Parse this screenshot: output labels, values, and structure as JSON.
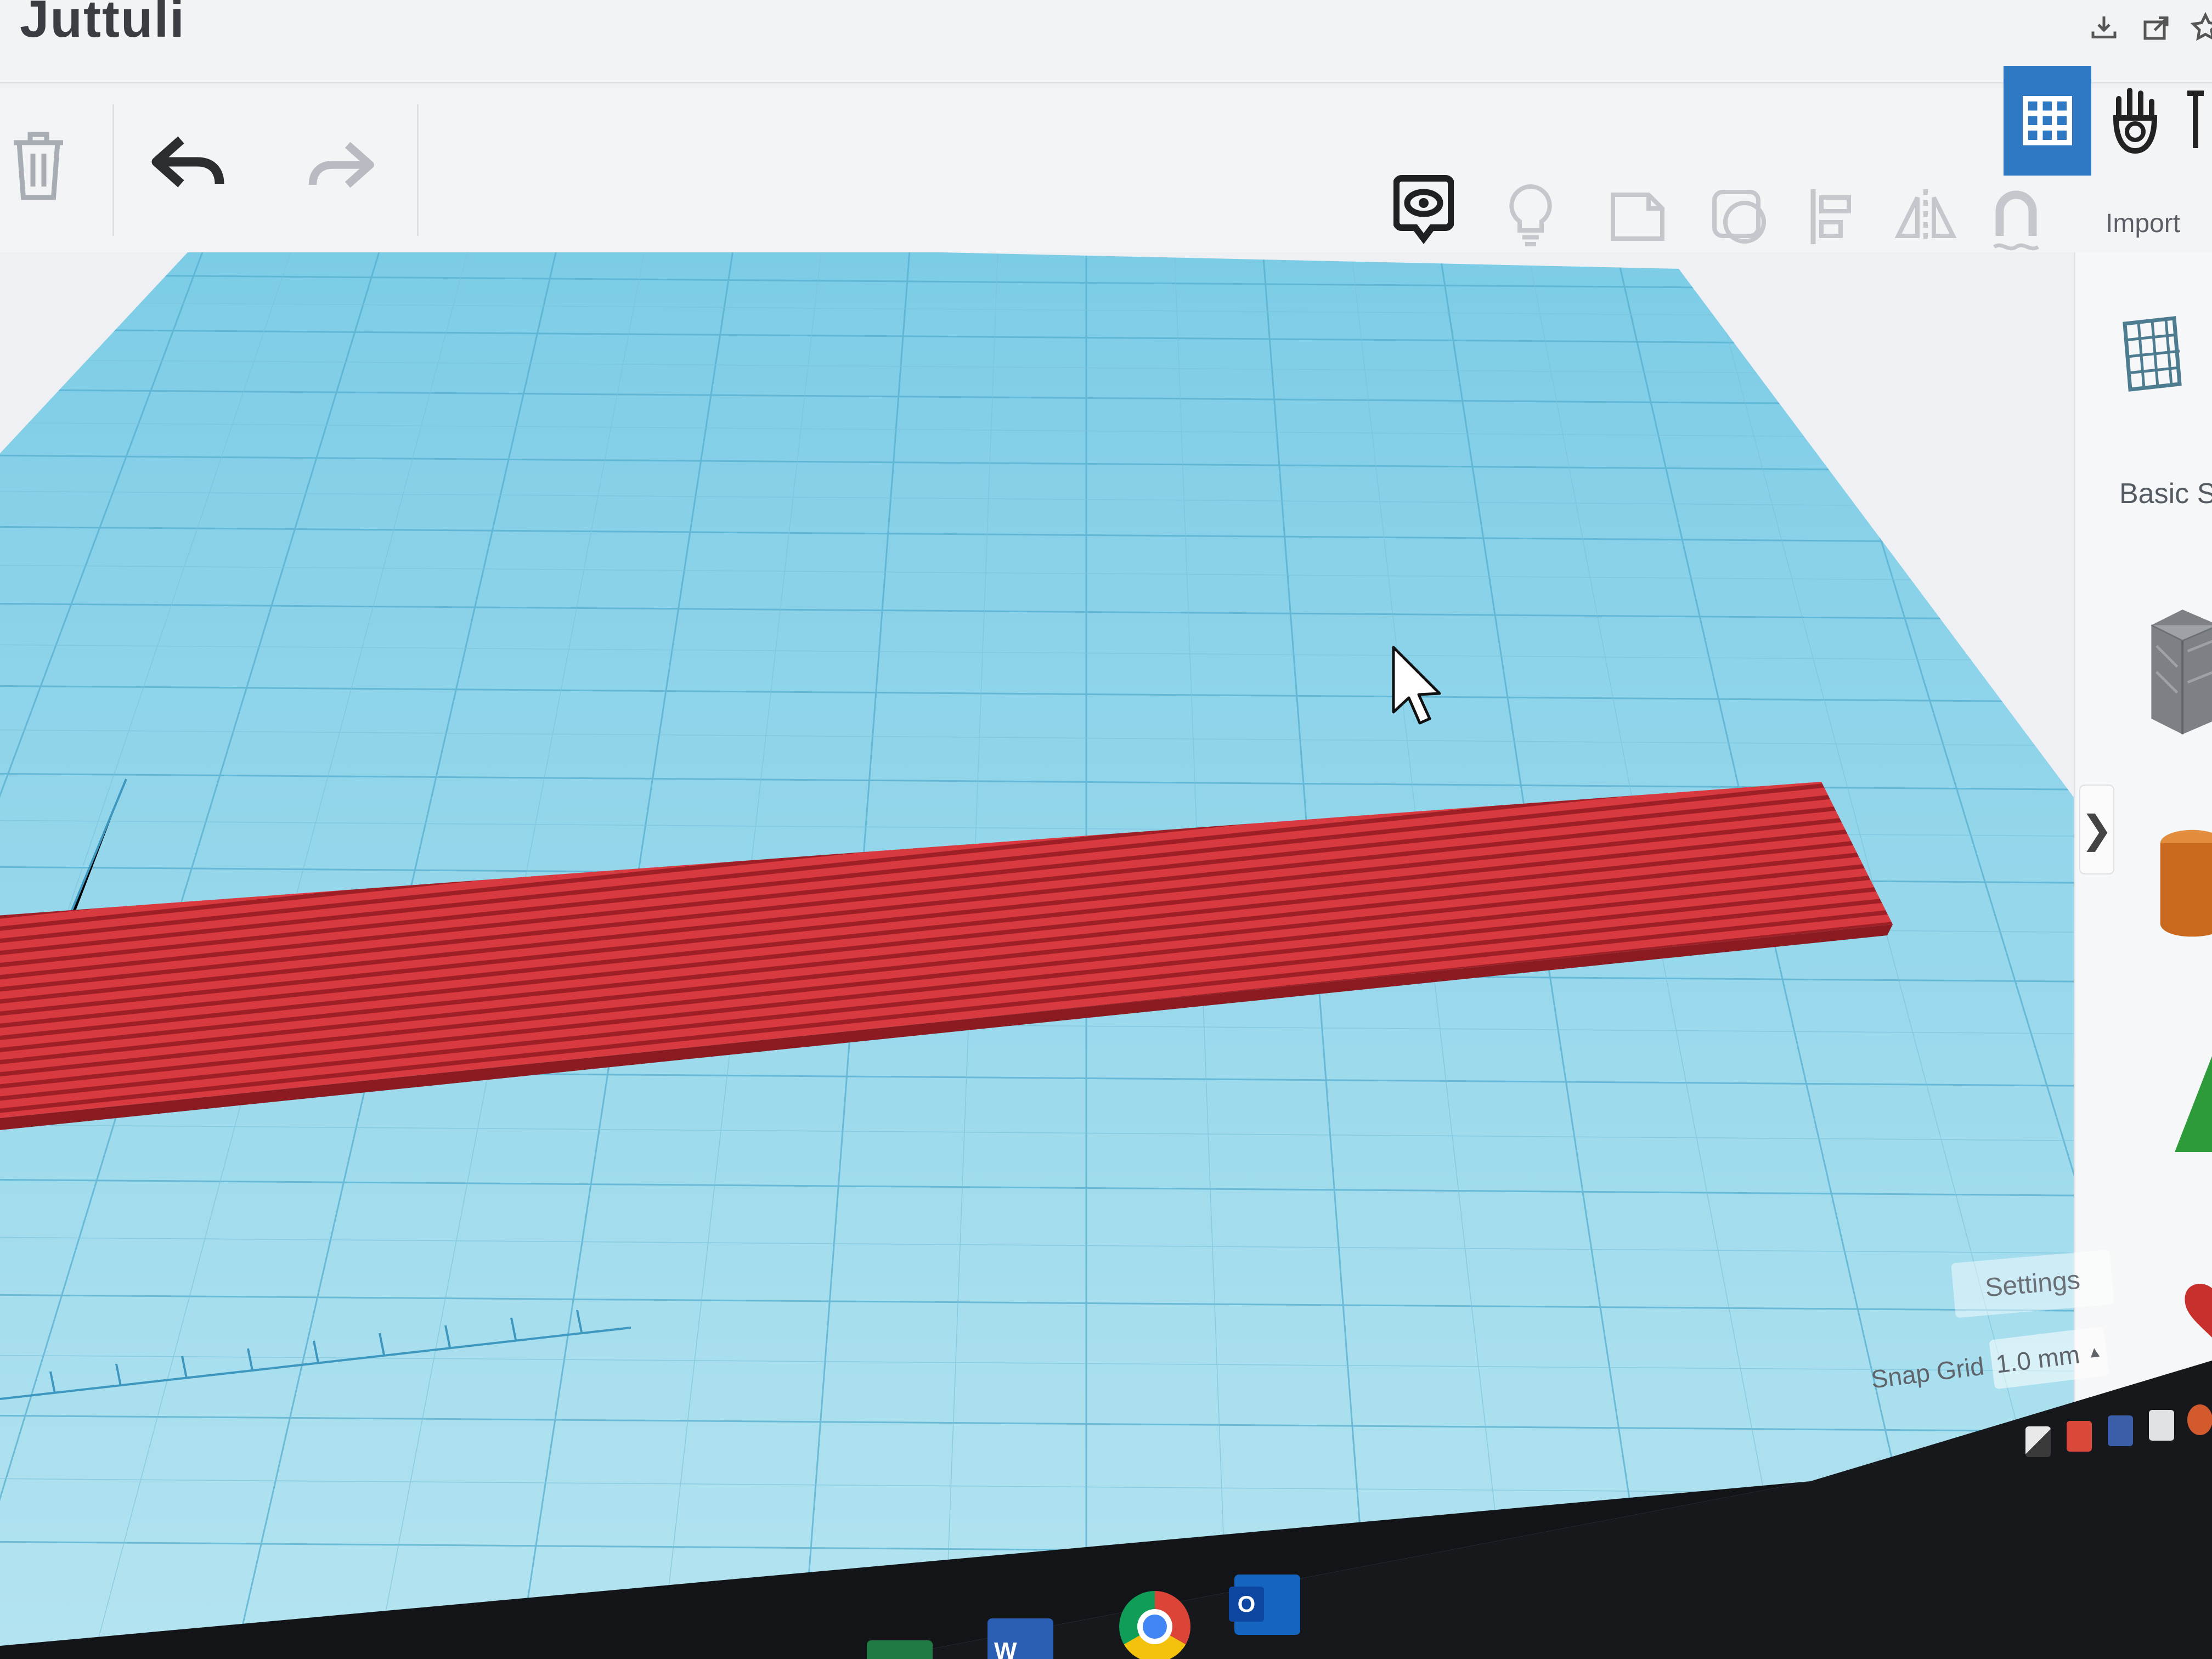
{
  "app": {
    "document_title": "Juttuli"
  },
  "toolbar": {
    "delete": {
      "icon": "trash-icon"
    },
    "undo": {
      "icon": "undo-arrow-icon"
    },
    "redo": {
      "icon": "redo-arrow-icon"
    },
    "view_tools": [
      {
        "icon": "show-all-icon"
      },
      {
        "icon": "lightbulb-icon"
      },
      {
        "icon": "note-icon"
      },
      {
        "icon": "group-shapes-icon"
      },
      {
        "icon": "align-icon"
      },
      {
        "icon": "mirror-icon"
      },
      {
        "icon": "magnet-icon"
      }
    ],
    "import_label": "Import"
  },
  "view_tabs": [
    {
      "icon": "grid-view-icon",
      "active": true
    },
    {
      "icon": "tinker-hand-icon",
      "active": false
    }
  ],
  "shapes_panel": {
    "category_label": "Basic Sh",
    "shapes": [
      {
        "icon": "box-shape-icon",
        "color": "#7d8186"
      },
      {
        "icon": "cylinder-shape-icon",
        "color": "#c9681f"
      },
      {
        "icon": "roof-shape-icon",
        "color": "#2e9b3b"
      },
      {
        "icon": "heart-shape-icon",
        "color": "#c8302d"
      }
    ]
  },
  "workplane": {
    "settings_label": "Settings",
    "snap_grid_label": "Snap Grid",
    "snap_grid_value": "1.0 mm",
    "grid_color": "#6fc4df",
    "object_color": "#d7353b"
  },
  "taskbar": {
    "apps": [
      {
        "icon": "excel-icon"
      },
      {
        "icon": "word-icon"
      },
      {
        "icon": "chrome-icon"
      },
      {
        "icon": "outlook-icon"
      }
    ],
    "tray": [
      {
        "icon": "shield-icon"
      },
      {
        "icon": "antivirus-icon"
      },
      {
        "icon": "network-icon"
      },
      {
        "icon": "usb-icon"
      },
      {
        "icon": "app-tray-icon"
      }
    ]
  },
  "colors": {
    "accent": "#2f78c4",
    "toolbar_bg": "#f3f4f6",
    "workplane_blue": "#8fd3ea"
  }
}
